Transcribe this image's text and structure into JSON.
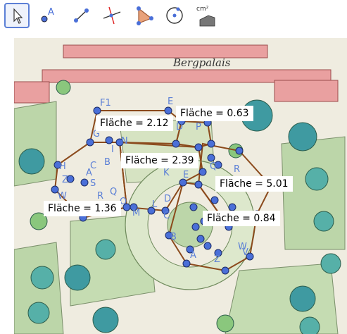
{
  "toolbar": {
    "tools": [
      {
        "name": "move",
        "icon": "arrow-cursor-icon"
      },
      {
        "name": "point",
        "icon": "point-icon",
        "letter": "A"
      },
      {
        "name": "segment",
        "icon": "segment-icon"
      },
      {
        "name": "perpendicular-line",
        "icon": "perpendicular-line-icon"
      },
      {
        "name": "polygon",
        "icon": "polygon-icon"
      },
      {
        "name": "circle",
        "icon": "circle-icon"
      },
      {
        "name": "area",
        "icon": "area-measure-icon",
        "unit": "cm²"
      }
    ],
    "active_tool": "move"
  },
  "background": {
    "title": "Bergpalais"
  },
  "areas": [
    {
      "label": "Fläche = 0.63"
    },
    {
      "label": "Fläche = 2.12"
    },
    {
      "label": "Fläche = 2.39"
    },
    {
      "label": "Fläche = 5.01"
    },
    {
      "label": "Fläche = 1.36"
    },
    {
      "label": "Fläche = 0.84"
    }
  ],
  "point_labels": [
    "F1",
    "E",
    "G",
    "I",
    "C",
    "B",
    "N",
    "D",
    "K",
    "E",
    "P",
    "Q",
    "R",
    "H",
    "Z",
    "A",
    "S",
    "W",
    "R",
    "Q",
    "O",
    "M",
    "L",
    "D",
    "C",
    "B",
    "A",
    "Z",
    "V",
    "W"
  ],
  "colors": {
    "point": "#4a6fd8",
    "polygon_edge": "#8b4a1c",
    "active_border": "#5b7fd6"
  }
}
